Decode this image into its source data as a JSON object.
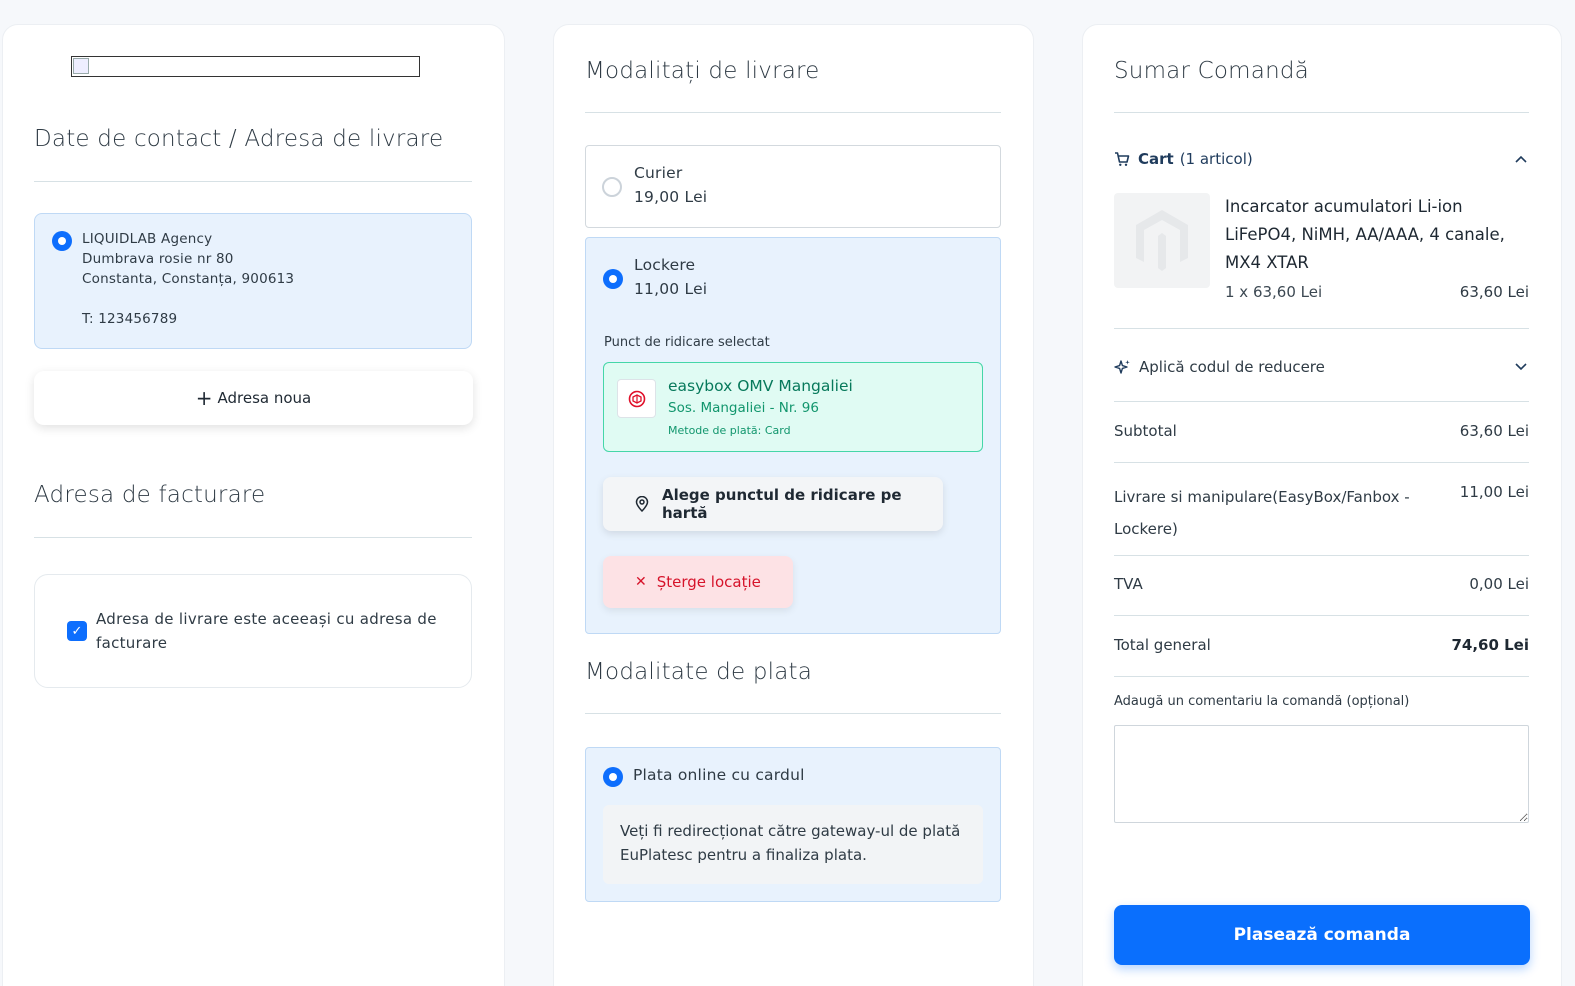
{
  "contact": {
    "logo_alt": "",
    "title": "Date de contact / Adresa de livrare",
    "address": {
      "name": "LIQUIDLAB Agency",
      "street": "Dumbrava rosie nr 80",
      "city": "Constanta, Constanța, 900613",
      "phone": "T: 123456789",
      "selected": true
    },
    "new_address_label": "Adresa noua"
  },
  "billing": {
    "title": "Adresa de facturare",
    "same_as_shipping_label": "Adresa de livrare este aceeași cu adresa de facturare",
    "same_as_shipping_checked": true
  },
  "shipping": {
    "title": "Modalitați de livrare",
    "options": [
      {
        "label": "Curier",
        "price": "19,00 Lei",
        "selected": false
      },
      {
        "label": "Lockere",
        "price": "11,00 Lei",
        "selected": true
      }
    ],
    "pickup_label": "Punct de ridicare selectat",
    "pickup_point": {
      "name": "easybox OMV Mangaliei",
      "address": "Sos. Mangaliei - Nr. 96",
      "payment": "Metode de plată: Card"
    },
    "map_button": "Alege punctul de ridicare pe hartă",
    "delete_button": "Șterge locație"
  },
  "payment": {
    "title": "Modalitate de plata",
    "option_label": "Plata online cu cardul",
    "note": "Veți fi redirecționat către gateway-ul de plată EuPlatesc pentru a finaliza plata."
  },
  "summary": {
    "title": "Sumar Comandă",
    "cart_label": "Cart",
    "cart_count": "(1 articol)",
    "product": {
      "name": "Incarcator acumulatori Li-ion LiFePO4, NiMH, AA/AAA, 4 canale, MX4 XTAR",
      "qty_price": "1 x 63,60 Lei",
      "total": "63,60 Lei"
    },
    "discount_label": "Aplică codul de reducere",
    "rows": [
      {
        "label": "Subtotal",
        "value": "63,60 Lei"
      },
      {
        "label": "Livrare si manipulare(EasyBox/Fanbox - Lockere)",
        "value": "11,00 Lei"
      },
      {
        "label": "TVA",
        "value": "0,00 Lei"
      },
      {
        "label": "Total general",
        "value": "74,60 Lei"
      }
    ],
    "comment_label": "Adaugă un comentariu la comandă (opțional)",
    "comment_value": "",
    "place_order": "Plasează comanda"
  },
  "colors": {
    "primary": "#0d6efd",
    "selected_bg": "#e8f2fd",
    "pickup_bg": "#e0fbf3",
    "pickup_text": "#07795b",
    "danger": "#d6132a",
    "danger_bg": "#fde2e5"
  }
}
